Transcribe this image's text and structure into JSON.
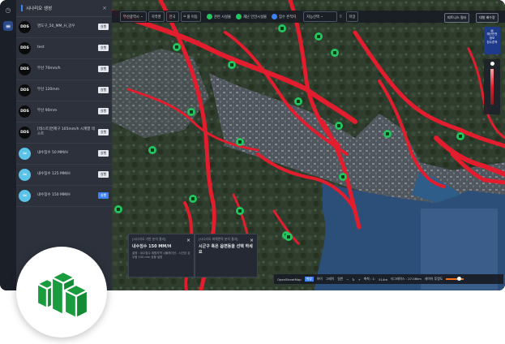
{
  "panel": {
    "title": "시나리오 생성",
    "close_icon": "close-icon"
  },
  "scenarios": [
    {
      "badge": "DDS",
      "label": "영도구_50_MM_H_강우",
      "run": "실행",
      "type": "dds"
    },
    {
      "badge": "DDS",
      "label": "test",
      "run": "실행",
      "type": "dds"
    },
    {
      "badge": "DDS",
      "label": "부산 70mm/h",
      "run": "실행",
      "type": "dds"
    },
    {
      "badge": "DDS",
      "label": "부산 120mm",
      "run": "실행",
      "type": "dds"
    },
    {
      "badge": "DDS",
      "label": "부산 90mm",
      "run": "실행",
      "type": "dds"
    },
    {
      "badge": "DDS",
      "label": "[테스트]연제구 105mm/h 시계열 테스트",
      "run": "실행",
      "type": "dds"
    },
    {
      "badge": "",
      "label": "내수침수 50 MM/H",
      "run": "실행",
      "type": "wave"
    },
    {
      "badge": "",
      "label": "내수침수 125 MM/H",
      "run": "실행",
      "type": "wave"
    },
    {
      "badge": "",
      "label": "내수침수 150 MM/H",
      "run": "실행",
      "type": "wave",
      "active": true
    }
  ],
  "toolbar": {
    "region_select": "부산광역시",
    "btn1": "지역명",
    "btn2": "전국",
    "btn3": "홈 이동",
    "layer1": "관련 시설물",
    "layer2": "재난 안전시설물",
    "layer3": "침수 흔적지",
    "search_placeholder": "지능선택",
    "save": "저장"
  },
  "right_buttons": {
    "b1": "피트니스 필터",
    "b2": "대형 배수량"
  },
  "side_box": {
    "line1": "재난안전",
    "line2": "정보",
    "line3": "침수흔적"
  },
  "popup1": {
    "title": "[시나리오 기반 분석 결과]",
    "main": "내수침수 150 MM/H",
    "body": "설명 : 내수침수 위험지역 시뮬레이션 - 시간당 강우량 150 mm 상황 설정"
  },
  "popup2": {
    "title": "[시나리오 피해면적 분석 결과]",
    "main": "시군구 혹은 읍면동을 선택 하세요"
  },
  "bottombar": {
    "basemap": "OpenStreetMap",
    "opt1": "위성",
    "opt2": "하이",
    "opt3": "그레이",
    "opt4": "일반",
    "scale": "514m",
    "zoom_label": "리그레이스 : 27.06km",
    "ratio_label": "축척 : 1:",
    "opacity_label": "레이어 투명도"
  },
  "colors": {
    "flood": "#e11d2e",
    "marker": "#22c55e",
    "sea": "#2b4f78",
    "accent": "#3b82f6",
    "logo": "#1a9c3e"
  }
}
